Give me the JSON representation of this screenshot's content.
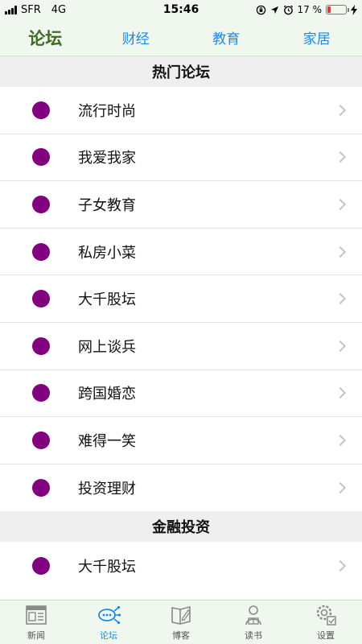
{
  "status_bar": {
    "carrier": "SFR",
    "network": "4G",
    "time": "15:46",
    "battery_percent": "17 %",
    "battery_level": 0.17
  },
  "top_nav": {
    "tabs": [
      {
        "label": "论坛",
        "active": true
      },
      {
        "label": "财经",
        "active": false
      },
      {
        "label": "教育",
        "active": false
      },
      {
        "label": "家居",
        "active": false
      }
    ]
  },
  "sections": [
    {
      "title": "热门论坛",
      "items": [
        "流行时尚",
        "我爱我家",
        "子女教育",
        "私房小菜",
        "大千股坛",
        "网上谈兵",
        "跨国婚恋",
        "难得一笑",
        "投资理财"
      ]
    },
    {
      "title": "金融投资",
      "items": [
        "大千股坛"
      ]
    }
  ],
  "tab_bar": {
    "items": [
      {
        "label": "新闻",
        "icon": "newspaper-icon"
      },
      {
        "label": "论坛",
        "icon": "forum-icon"
      },
      {
        "label": "博客",
        "icon": "blog-icon"
      },
      {
        "label": "读书",
        "icon": "reader-icon"
      },
      {
        "label": "设置",
        "icon": "settings-icon"
      }
    ],
    "active_index": 1
  },
  "colors": {
    "accent": "#1e88e5",
    "active_tab_text": "#3d6b2a",
    "bullet": "#800080",
    "bar_background": "#f0f7ee",
    "battery_low": "#e53935"
  }
}
